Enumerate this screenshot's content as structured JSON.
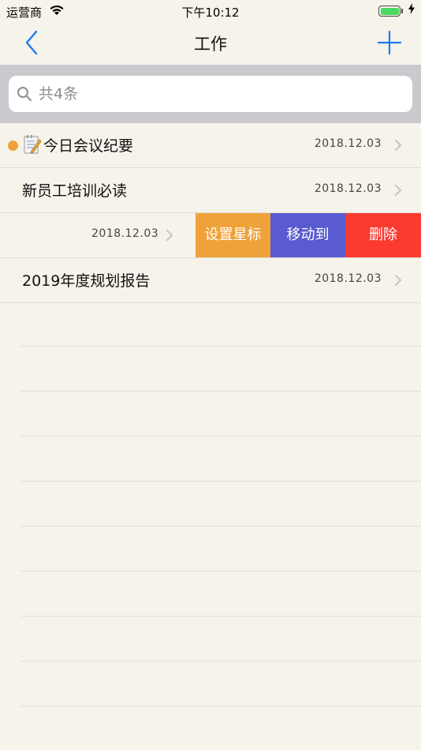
{
  "status_bar": {
    "carrier": "运营商",
    "time": "下午10:12",
    "battery_level": 1.0
  },
  "nav": {
    "title": "工作",
    "back_icon": "chevron-left-icon",
    "add_icon": "plus-icon"
  },
  "search": {
    "placeholder": "共4条",
    "icon": "search-icon"
  },
  "colors": {
    "accent": "#1a7cf5",
    "star_action": "#f0a23a",
    "move_action": "#5a5bd0",
    "delete_action": "#fb3b30",
    "search_bg": "#c9c9ce"
  },
  "notes": [
    {
      "title": "今日会议纪要",
      "date": "2018.12.03",
      "starred": true,
      "icon": "memo-icon"
    },
    {
      "title": "新员工培训必读",
      "date": "2018.12.03",
      "starred": false
    },
    {
      "title": "",
      "date": "2018.12.03",
      "starred": false,
      "swiped": true
    },
    {
      "title": "2019年度规划报告",
      "date": "2018.12.03",
      "starred": false
    }
  ],
  "swipe_actions": {
    "star": "设置星标",
    "move": "移动到",
    "delete": "删除"
  }
}
